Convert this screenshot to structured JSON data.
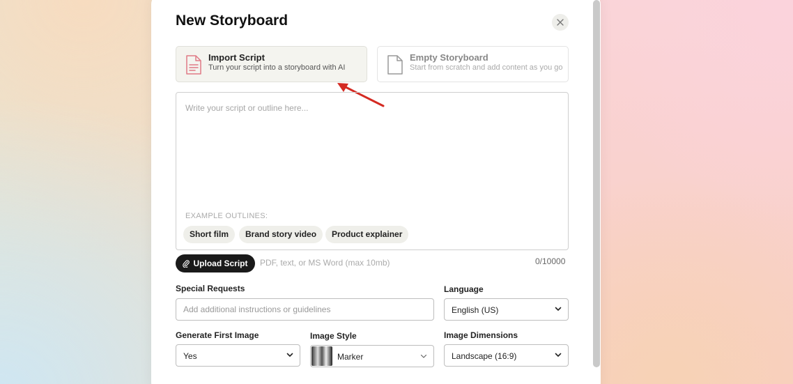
{
  "modal": {
    "title": "New Storyboard",
    "close_label": "×"
  },
  "options": {
    "import": {
      "title": "Import Script",
      "subtitle": "Turn your script into a storyboard with AI"
    },
    "empty": {
      "title": "Empty Storyboard",
      "subtitle": "Start from scratch and add content as you go"
    }
  },
  "script": {
    "placeholder": "Write your script or outline here...",
    "examples_label": "EXAMPLE OUTLINES:",
    "examples": [
      "Short film",
      "Brand story video",
      "Product explainer"
    ]
  },
  "upload": {
    "button_label": "Upload Script",
    "hint": "PDF, text, or MS Word (max 10mb)",
    "counter": "0/10000"
  },
  "special_requests": {
    "label": "Special Requests",
    "placeholder": "Add additional instructions or guidelines"
  },
  "language": {
    "label": "Language",
    "value": "English (US)"
  },
  "first_image": {
    "label": "Generate First Image",
    "value": "Yes"
  },
  "image_style": {
    "label": "Image Style",
    "value": "Marker"
  },
  "dimensions": {
    "label": "Image Dimensions",
    "value": "Landscape (16:9)"
  },
  "colors": {
    "arrow": "#d42a22",
    "accent_icon": "#e07a86"
  }
}
